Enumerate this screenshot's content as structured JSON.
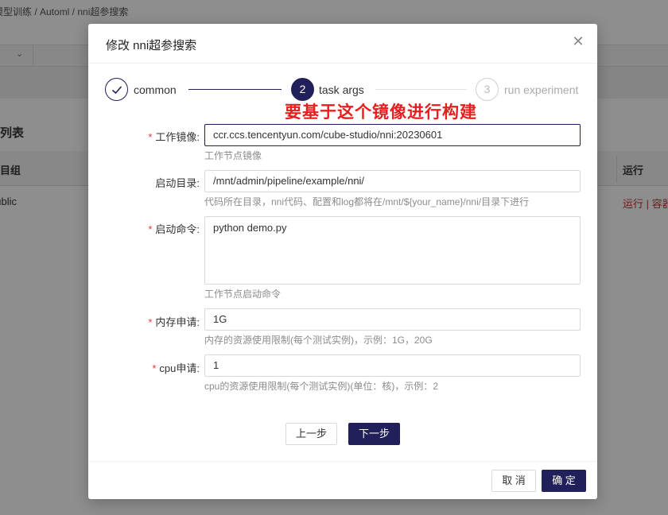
{
  "background": {
    "breadcrumb": "模型训练 / Automl / nni超参搜索",
    "section_title": "列表",
    "table_header_left": "项目组",
    "table_header_right": "运行",
    "row_left": "public",
    "row_actions": "运行 | 容器"
  },
  "modal": {
    "title": "修改 nni超参搜索",
    "close_icon": "close-icon"
  },
  "steps": [
    {
      "index": "✓",
      "label": "common",
      "status": "finish"
    },
    {
      "index": "2",
      "label": "task args",
      "status": "process"
    },
    {
      "index": "3",
      "label": "run experiment",
      "status": "wait"
    }
  ],
  "annotation": "要基于这个镜像进行构建",
  "form": {
    "image": {
      "label": "工作镜像:",
      "required": "*",
      "value": "ccr.ccs.tencentyun.com/cube-studio/nni:20230601",
      "help": "工作节点镜像"
    },
    "workdir": {
      "label": "启动目录:",
      "value": "/mnt/admin/pipeline/example/nni/",
      "help": "代码所在目录，nni代码、配置和log都将在/mnt/${your_name}/nni/目录下进行"
    },
    "command": {
      "label": "启动命令:",
      "required": "*",
      "value": "python demo.py",
      "help": "工作节点启动命令"
    },
    "memory": {
      "label": "内存申请:",
      "required": "*",
      "value": "1G",
      "help": "内存的资源使用限制(每个测试实例)，示例：1G，20G"
    },
    "cpu": {
      "label": "cpu申请:",
      "required": "*",
      "value": "1",
      "help": "cpu的资源使用限制(每个测试实例)(单位：核)，示例：2"
    }
  },
  "buttons": {
    "prev": "上一步",
    "next": "下一步",
    "cancel": "取 消",
    "ok": "确 定"
  },
  "colors": {
    "primary": "#22205a",
    "required": "#e8383d",
    "annotation": "#e81e1e"
  }
}
